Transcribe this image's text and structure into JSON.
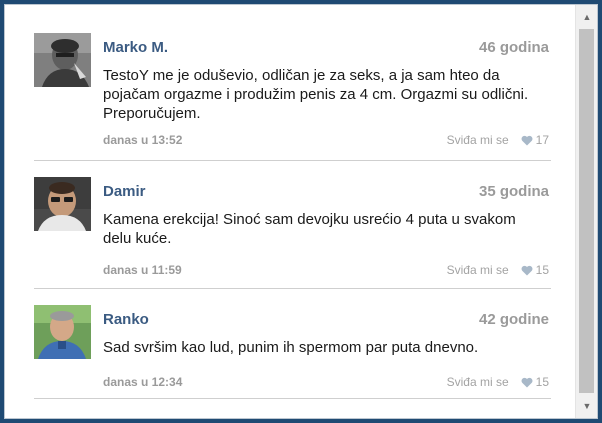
{
  "comments": [
    {
      "name": "Marko M.",
      "age": "46 godina",
      "text": "TestoY me je oduševio, odličan je za seks, a ja sam hteo da pojačam orgazme i produžim penis za 4 cm. Orgazmi su odlični. Preporučujem.",
      "time": "danas u 13:52",
      "like_label": "Sviđa mi se",
      "likes": "17"
    },
    {
      "name": "Damir",
      "age": "35 godina",
      "text": "Kamena erekcija! Sinoć sam devojku usrećio 4 puta u svakom delu kuće.",
      "time": "danas u 11:59",
      "like_label": "Sviđa mi se",
      "likes": "15"
    },
    {
      "name": "Ranko",
      "age": "42 godine",
      "text": "Sad svršim kao lud, punim ih spermom par puta dnevno.",
      "time": "danas u 12:34",
      "like_label": "Sviđa mi se",
      "likes": "15"
    }
  ],
  "scrollbar": {
    "up_icon": "▲",
    "down_icon": "▼"
  },
  "colors": {
    "name": "#3b5b82",
    "muted": "#9a9a9a",
    "frame": "#1f4a73"
  }
}
